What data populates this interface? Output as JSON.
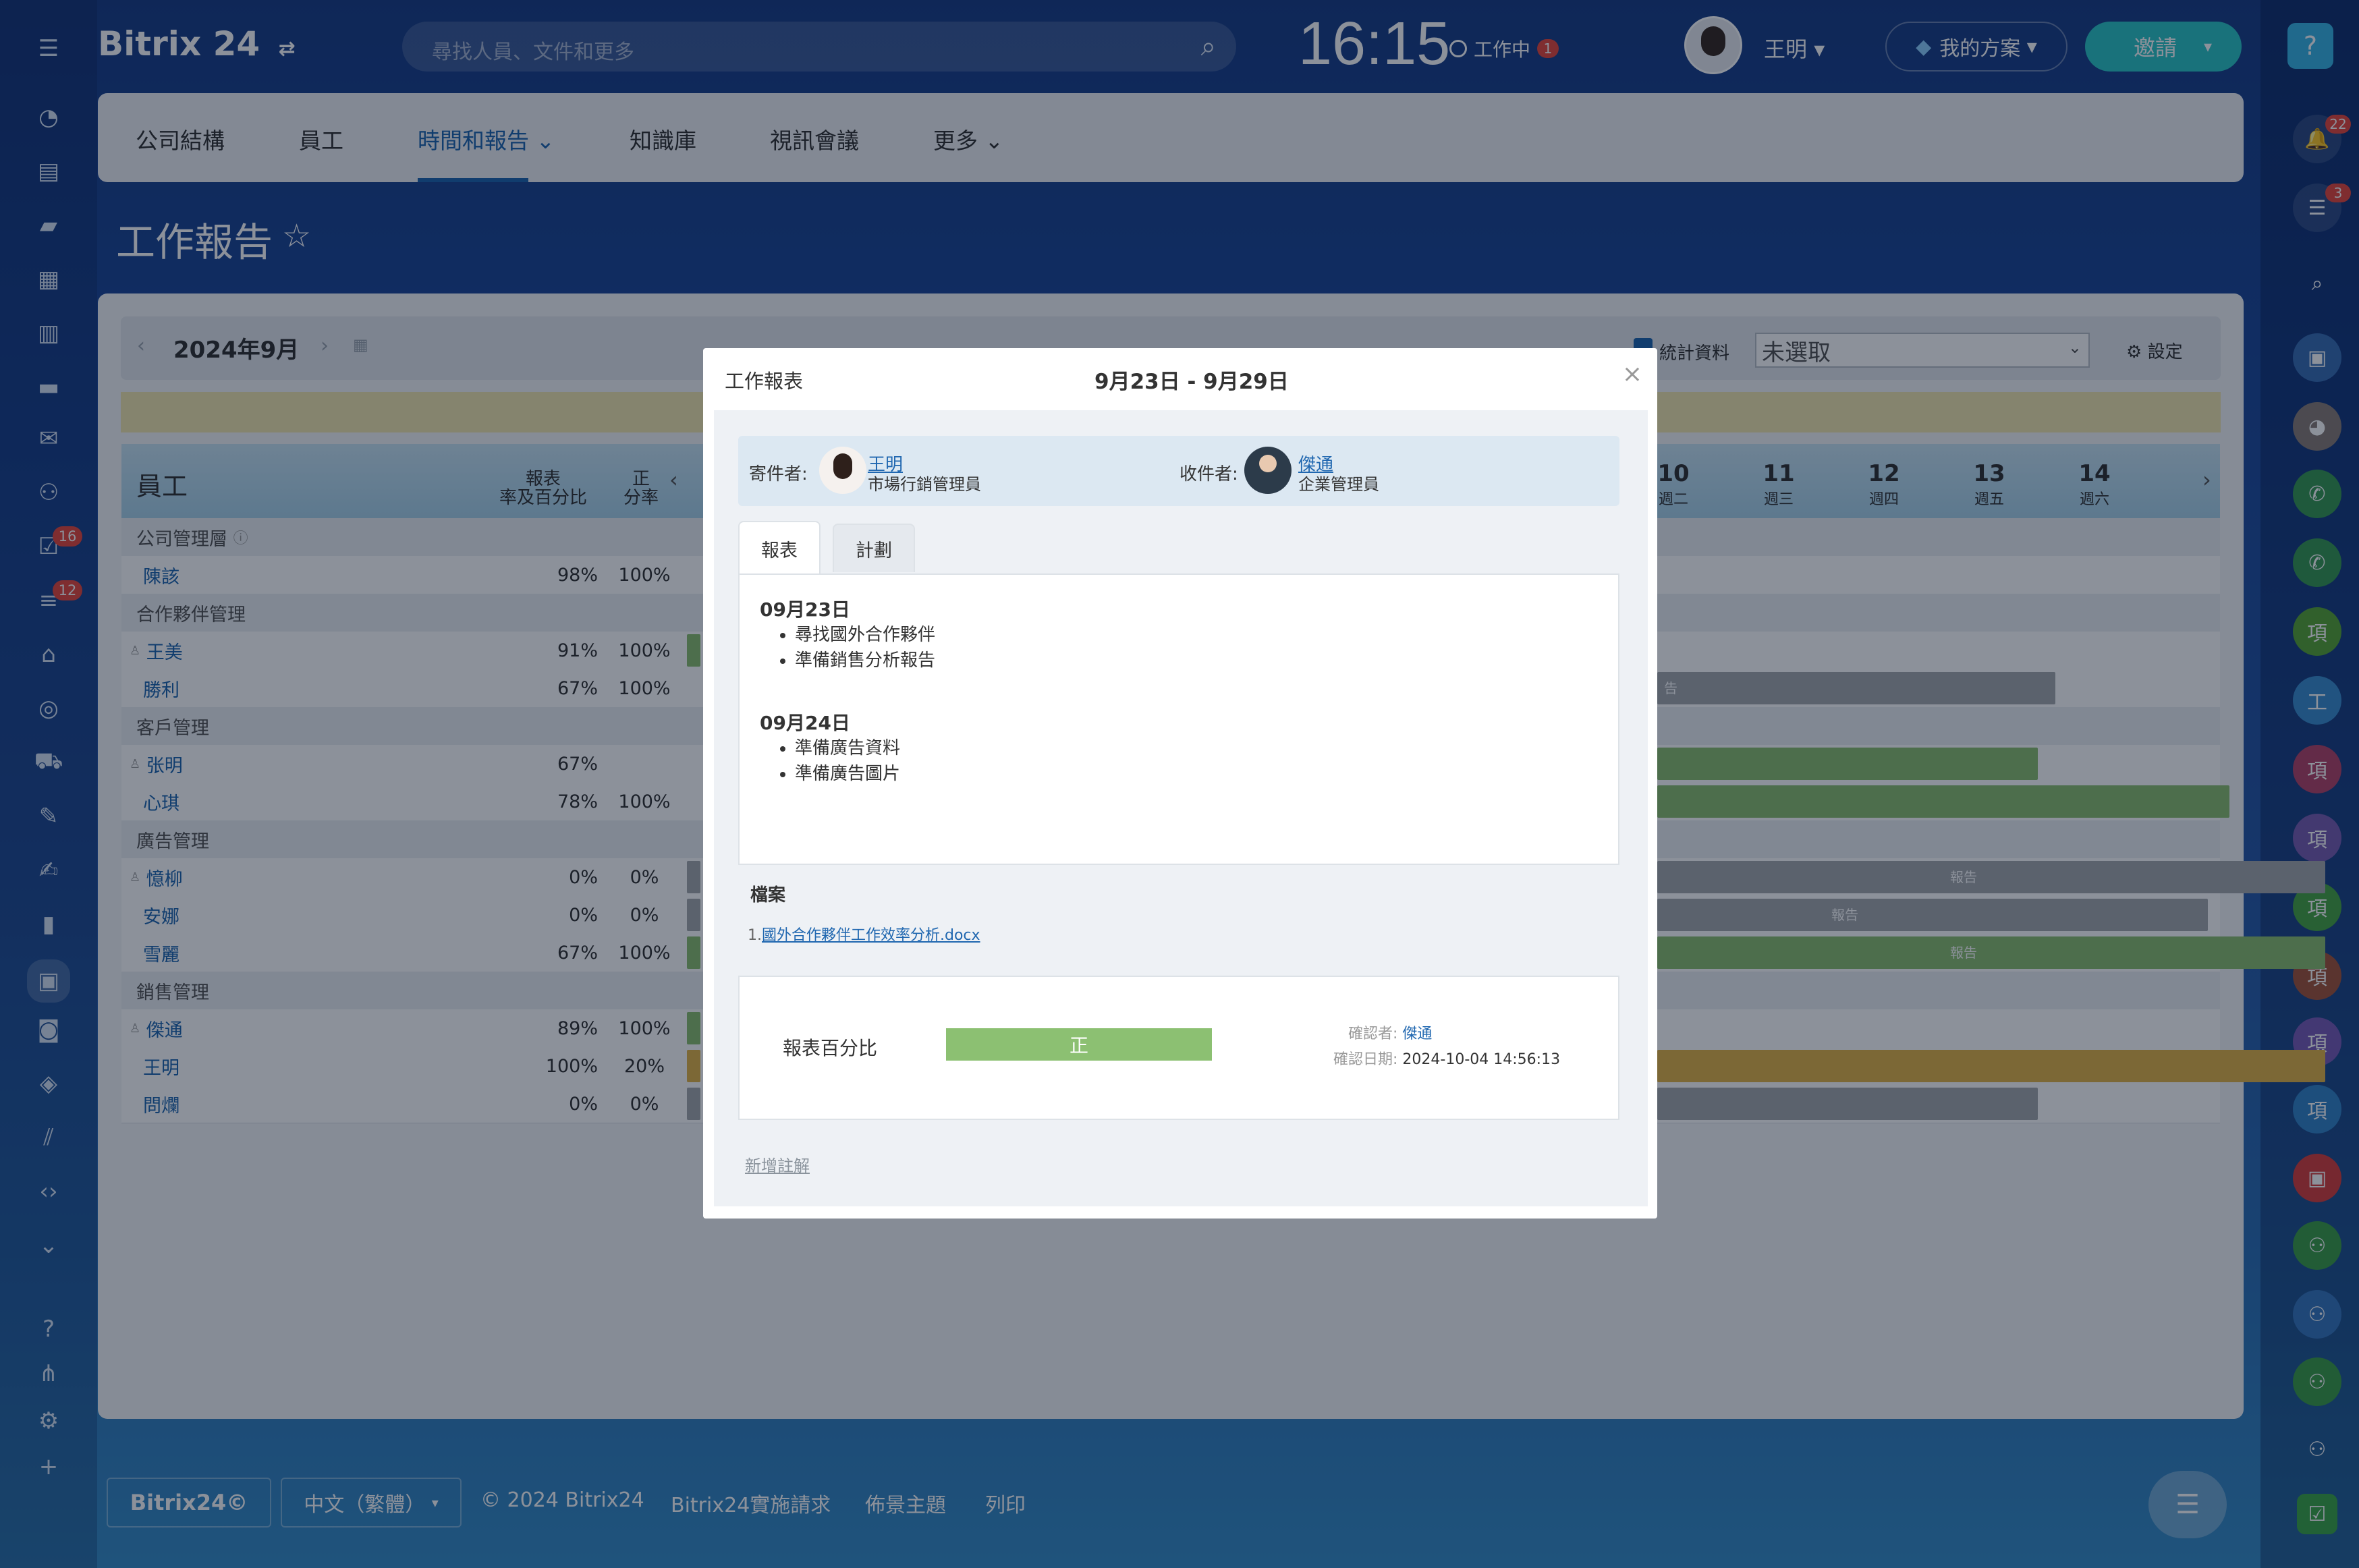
{
  "header": {
    "logo": "Bitrix 24",
    "search_placeholder": "尋找人員、文件和更多",
    "clock": "16:15",
    "work_status": "工作中",
    "work_status_badge": "1",
    "user_name": "王明",
    "plan_label": "我的方案",
    "invite_label": "邀請"
  },
  "leftbar": {
    "badges": [
      "16",
      "12"
    ]
  },
  "rightbar": {
    "badges": [
      "22",
      "3"
    ],
    "chat_letters": [
      "項",
      "工",
      "項",
      "項",
      "項",
      "項",
      "項",
      "項"
    ]
  },
  "nav": {
    "items": [
      "公司結構",
      "員工",
      "時間和報告",
      "知識庫",
      "視訊會議",
      "更多"
    ],
    "active_index": 2
  },
  "page": {
    "title": "工作報告"
  },
  "toolbar": {
    "month": "2024年9月",
    "stats_label": "統計資料",
    "select_value": "未選取",
    "settings_label": "設定"
  },
  "table": {
    "headers": {
      "employee": "員工",
      "report_pct": "報表\n率及百分比",
      "pos_pct": "正\n分率"
    },
    "days": [
      {
        "num": "10",
        "wd": "週二"
      },
      {
        "num": "11",
        "wd": "週三"
      },
      {
        "num": "12",
        "wd": "週四"
      },
      {
        "num": "13",
        "wd": "週五"
      },
      {
        "num": "14",
        "wd": "週六"
      }
    ],
    "rows": [
      {
        "type": "group",
        "name": "公司管理層"
      },
      {
        "type": "emp",
        "name": "陳該",
        "a": "98%",
        "b": "100%"
      },
      {
        "type": "group",
        "name": "合作夥伴管理"
      },
      {
        "type": "emp",
        "name": "王美",
        "a": "91%",
        "b": "100%"
      },
      {
        "type": "emp",
        "name": "勝利",
        "a": "67%",
        "b": "100%"
      },
      {
        "type": "group",
        "name": "客戶管理"
      },
      {
        "type": "emp",
        "name": "张明",
        "a": "67%",
        "b": ""
      },
      {
        "type": "emp",
        "name": "心琪",
        "a": "78%",
        "b": "100%"
      },
      {
        "type": "group",
        "name": "廣告管理"
      },
      {
        "type": "emp",
        "name": "憶柳",
        "a": "0%",
        "b": "0%"
      },
      {
        "type": "emp",
        "name": "安娜",
        "a": "0%",
        "b": "0%"
      },
      {
        "type": "emp",
        "name": "雪麗",
        "a": "67%",
        "b": "100%"
      },
      {
        "type": "group",
        "name": "銷售管理"
      },
      {
        "type": "emp",
        "name": "傑通",
        "a": "89%",
        "b": "100%"
      },
      {
        "type": "emp",
        "name": "王明",
        "a": "100%",
        "b": "20%"
      },
      {
        "type": "emp",
        "name": "問爛",
        "a": "0%",
        "b": "0%"
      }
    ],
    "bar_labels": [
      "告",
      "報告",
      "報告",
      "報告"
    ]
  },
  "modal": {
    "title": "工作報表",
    "date_range": "9月23日 - 9月29日",
    "close": "×",
    "sender_label": "寄件者:",
    "sender_name": "王明",
    "sender_role": "市場行銷管理員",
    "recipient_label": "收件者:",
    "recipient_name": "傑通",
    "recipient_role": "企業管理員",
    "tabs": [
      "報表",
      "計劃"
    ],
    "report": [
      {
        "date": "09月23日",
        "items": [
          "尋找國外合作夥伴",
          "準備銷售分析報告"
        ]
      },
      {
        "date": "09月24日",
        "items": [
          "準備廣告資料",
          "準備廣告圖片"
        ]
      }
    ],
    "files_label": "檔案",
    "file_index": "1.",
    "file_name": "國外合作夥伴工作效率分析.docx",
    "score_label": "報表百分比",
    "score_value": "正",
    "confirmed_by_label": "確認者:",
    "confirmed_by": "傑通",
    "confirmed_date_label": "確認日期:",
    "confirmed_date": "2024-10-04 14:56:13",
    "add_comment": "新增註解"
  },
  "footer": {
    "brand": "Bitrix24©",
    "language": "中文（繁體）",
    "copyright": "© 2024 Bitrix24",
    "links": [
      "Bitrix24實施請求",
      "佈景主題",
      "列印"
    ]
  },
  "colors": {
    "accent": "#2fc6c6",
    "green_bar": "#8cc072",
    "gray_bar": "#a7aaae",
    "yellow_bar": "#e2b44a",
    "link": "#2067b0"
  }
}
